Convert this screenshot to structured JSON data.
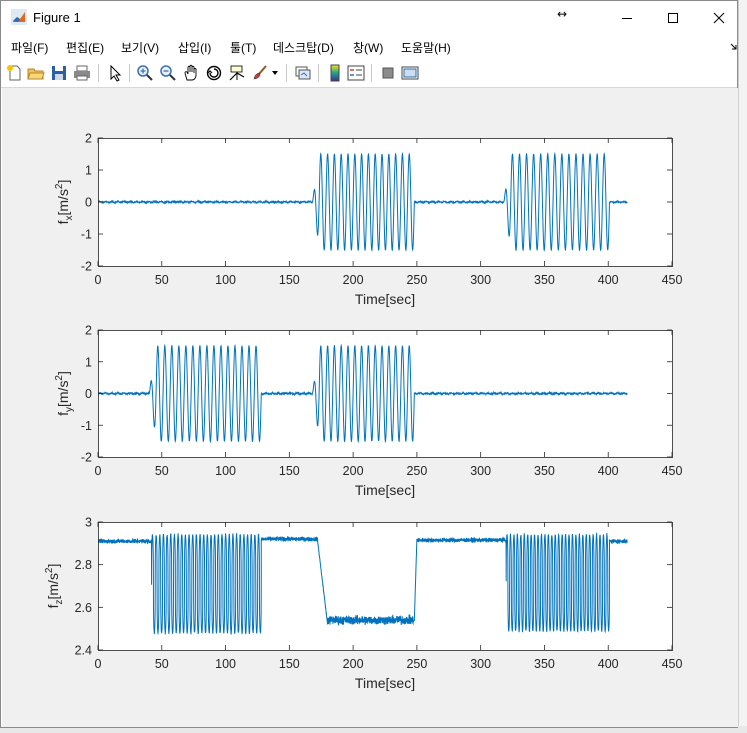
{
  "window": {
    "title": "Figure 1",
    "controls": [
      "minimize",
      "maximize",
      "close"
    ]
  },
  "menu": {
    "items": [
      {
        "label": "파일(F)"
      },
      {
        "label": "편집(E)"
      },
      {
        "label": "보기(V)"
      },
      {
        "label": "삽입(I)"
      },
      {
        "label": "툴(T)"
      },
      {
        "label": "데스크탑(D)"
      },
      {
        "label": "창(W)"
      },
      {
        "label": "도움말(H)"
      }
    ]
  },
  "toolbar": {
    "icons": [
      "new-figure-icon",
      "open-file-icon",
      "save-icon",
      "print-icon",
      "select-arrow-icon",
      "zoom-in-icon",
      "zoom-out-icon",
      "pan-hand-icon",
      "rotate-3d-icon",
      "data-cursor-icon",
      "brush-icon",
      "brush-dropdown-icon",
      "link-plot-icon",
      "colorbar-icon",
      "legend-icon",
      "hide-plot-tools-icon",
      "show-plot-tools-icon"
    ]
  },
  "colors": {
    "line": "#0072BD",
    "figure_bg": "#F0F0F0",
    "axes_bg": "#FFFFFF"
  },
  "chart_data": [
    {
      "type": "line",
      "ylabel": "f_x[m/s^2]",
      "ylabel_main": "f",
      "ylabel_sub": "x",
      "ylabel_unit": "[m/s",
      "ylabel_sup": "2",
      "ylabel_close": "]",
      "xlabel": "Time[sec]",
      "xlim": [
        0,
        450
      ],
      "ylim": [
        -2,
        2
      ],
      "xticks": [
        "0",
        "50",
        "100",
        "150",
        "200",
        "250",
        "300",
        "350",
        "400",
        "450"
      ],
      "yticks": [
        "2",
        "1",
        "0",
        "-1",
        "-2"
      ],
      "series": [
        {
          "baseline": 0,
          "noise_amplitude": 0.02,
          "oscillation_segments": [
            {
              "start": 168,
              "end": 248,
              "amplitude": 1.5,
              "cycles": 15
            },
            {
              "start": 318,
              "end": 401,
              "amplitude": 1.5,
              "cycles": 15
            }
          ],
          "end_time": 415
        }
      ]
    },
    {
      "type": "line",
      "ylabel": "f_y[m/s^2]",
      "ylabel_main": "f",
      "ylabel_sub": "y",
      "ylabel_unit": "[m/s",
      "ylabel_sup": "2",
      "ylabel_close": "]",
      "xlabel": "Time[sec]",
      "xlim": [
        0,
        450
      ],
      "ylim": [
        -2,
        2
      ],
      "xticks": [
        "0",
        "50",
        "100",
        "150",
        "200",
        "250",
        "300",
        "350",
        "400",
        "450"
      ],
      "yticks": [
        "2",
        "1",
        "0",
        "-1",
        "-2"
      ],
      "series": [
        {
          "baseline": 0,
          "noise_amplitude": 0.03,
          "oscillation_segments": [
            {
              "start": 40,
              "end": 128,
              "amplitude": 1.5,
              "cycles": 16
            },
            {
              "start": 168,
              "end": 248,
              "amplitude": 1.5,
              "cycles": 15
            }
          ],
          "end_time": 415
        }
      ]
    },
    {
      "type": "line",
      "ylabel": "f_z[m/s^2]",
      "ylabel_main": "f",
      "ylabel_sub": "z",
      "ylabel_unit": "[m/s",
      "ylabel_sup": "2",
      "ylabel_close": "]",
      "xlabel": "Time[sec]",
      "xlim": [
        0,
        450
      ],
      "ylim": [
        2.4,
        3
      ],
      "xticks": [
        "0",
        "50",
        "100",
        "150",
        "200",
        "250",
        "300",
        "350",
        "400",
        "450"
      ],
      "yticks": [
        "3",
        "2.8",
        "2.6",
        "2.4"
      ],
      "series": [
        {
          "segments": [
            {
              "kind": "noise",
              "start": 0,
              "end": 42,
              "level": 2.91,
              "noise": 0.015
            },
            {
              "kind": "osc",
              "start": 42,
              "end": 128,
              "high": 2.94,
              "low": 2.48,
              "cycles": 30
            },
            {
              "kind": "noise",
              "start": 128,
              "end": 172,
              "level": 2.92,
              "noise": 0.015
            },
            {
              "kind": "ramp",
              "start": 172,
              "end": 180,
              "from": 2.92,
              "to": 2.52
            },
            {
              "kind": "noise",
              "start": 180,
              "end": 248,
              "level": 2.54,
              "noise": 0.03
            },
            {
              "kind": "ramp",
              "start": 248,
              "end": 250,
              "from": 2.54,
              "to": 2.92
            },
            {
              "kind": "noise",
              "start": 250,
              "end": 320,
              "level": 2.915,
              "noise": 0.015
            },
            {
              "kind": "osc",
              "start": 320,
              "end": 401,
              "high": 2.94,
              "low": 2.49,
              "cycles": 30
            },
            {
              "kind": "noise",
              "start": 401,
              "end": 415,
              "level": 2.91,
              "noise": 0.015
            }
          ]
        }
      ]
    }
  ]
}
